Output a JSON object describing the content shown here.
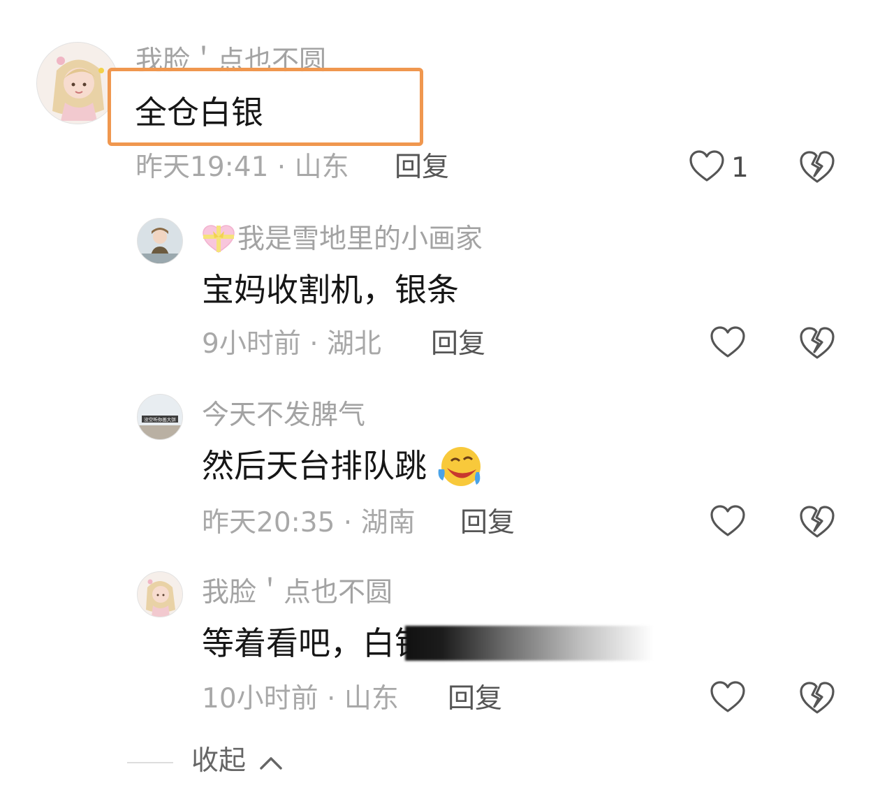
{
  "comments": [
    {
      "user": "我脸＇点也不圆",
      "text": "全仓白银",
      "time": "昨天19:41 · 山东",
      "reply": "回复",
      "likes": "1"
    }
  ],
  "replies": [
    {
      "user": "我是雪地里的小画家",
      "text": "宝妈收割机，银条",
      "time": "9小时前 · 湖北",
      "reply": "回复"
    },
    {
      "user": "今天不发脾气",
      "text": "然后天台排队跳",
      "time": "昨天20:35 · 湖南",
      "reply": "回复",
      "avatar_caption": "没空听你画大饼"
    },
    {
      "user": "我脸＇点也不圆",
      "text": "等着看吧，白银",
      "time": "10小时前 · 山东",
      "reply": "回复"
    }
  ],
  "collapse_label": "收起",
  "icons": [
    "heart-outline-icon",
    "broken-heart-icon",
    "heart-emoji-icon",
    "laughing-crying-emoji-icon",
    "chevron-up-icon"
  ],
  "colors": {
    "highlight": "#f0974f",
    "text": "#161616",
    "meta": "#a8a8a8"
  }
}
